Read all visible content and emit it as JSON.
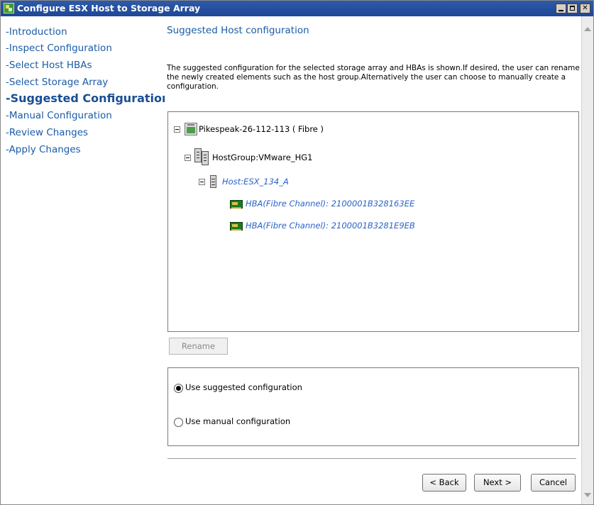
{
  "window": {
    "title": "Configure ESX Host to Storage Array"
  },
  "sidebar": {
    "items": [
      {
        "label": "-Introduction",
        "active": false
      },
      {
        "label": "-Inspect Configuration",
        "active": false
      },
      {
        "label": "-Select Host HBAs",
        "active": false
      },
      {
        "label": "-Select Storage Array",
        "active": false
      },
      {
        "label": "-Suggested Configuration",
        "active": true
      },
      {
        "label": "-Manual Configuration",
        "active": false
      },
      {
        "label": "-Review Changes",
        "active": false
      },
      {
        "label": "-Apply Changes",
        "active": false
      }
    ]
  },
  "content": {
    "title": "Suggested Host configuration",
    "description": "The suggested configuration for the selected storage array and HBAs is shown.If desired, the user can rename the newly created elements such as the host group.Alternatively the user can choose to manually create a configuration."
  },
  "tree": {
    "array": {
      "label": "Pikespeak-26-112-113 ( Fibre )",
      "icon": "storage-array-icon"
    },
    "hostgroup": {
      "label": "HostGroup:VMware_HG1",
      "icon": "host-group-icon"
    },
    "host": {
      "label": "Host:ESX_134_A",
      "icon": "host-icon"
    },
    "hbas": [
      {
        "label": "HBA(Fibre Channel): 2100001B328163EE",
        "icon": "hba-card-icon"
      },
      {
        "label": "HBA(Fibre Channel): 2100001B3281E9EB",
        "icon": "hba-card-icon"
      }
    ]
  },
  "buttons": {
    "rename": "Rename",
    "back": "< Back",
    "next": "Next >",
    "cancel": "Cancel"
  },
  "options": {
    "suggested_label": "Use suggested configuration",
    "manual_label": "Use manual configuration",
    "selected": "suggested"
  },
  "colors": {
    "titlebar": "#1f4796",
    "nav_link": "#1a5ba8",
    "tree_link": "#2a63c9"
  }
}
